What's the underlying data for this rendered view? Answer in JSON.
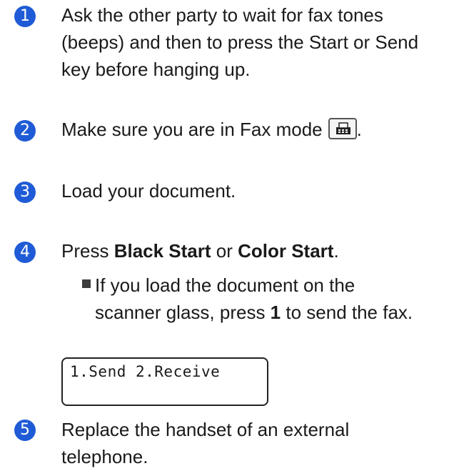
{
  "steps": [
    {
      "number": "1",
      "text": "Ask the other party to wait for fax tones (beeps) and then to press the Start or Send key before hanging up."
    },
    {
      "number": "2",
      "text_before": "Make sure you are in Fax mode",
      "text_after": "."
    },
    {
      "number": "3",
      "text": "Load your document."
    },
    {
      "number": "4",
      "text_prefix": "Press ",
      "key1": "Black Start",
      "text_mid": " or ",
      "key2": "Color Start",
      "text_suffix": "."
    },
    {
      "number": "5",
      "text": "Replace the handset of an external telephone."
    }
  ],
  "sub_bullet": {
    "prefix": "If you load the document on the scanner glass, press ",
    "key": "1",
    "suffix": " to send the fax."
  },
  "lcd": {
    "display": "1.Send 2.Receive"
  },
  "icons": {
    "fax_mode": "fax-mode-icon"
  },
  "colors": {
    "step_badge": "#1f5bd6"
  }
}
